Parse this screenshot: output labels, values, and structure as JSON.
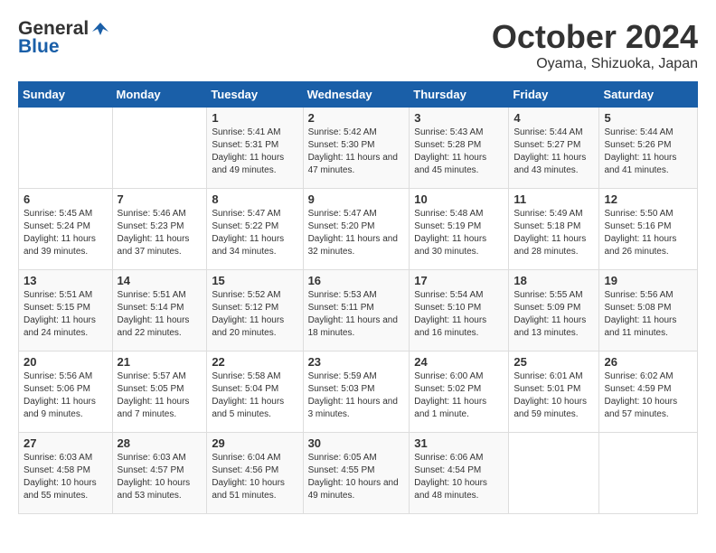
{
  "logo": {
    "general": "General",
    "blue": "Blue"
  },
  "title": "October 2024",
  "location": "Oyama, Shizuoka, Japan",
  "days_of_week": [
    "Sunday",
    "Monday",
    "Tuesday",
    "Wednesday",
    "Thursday",
    "Friday",
    "Saturday"
  ],
  "weeks": [
    [
      {
        "day": "",
        "sunrise": "",
        "sunset": "",
        "daylight": ""
      },
      {
        "day": "",
        "sunrise": "",
        "sunset": "",
        "daylight": ""
      },
      {
        "day": "1",
        "sunrise": "Sunrise: 5:41 AM",
        "sunset": "Sunset: 5:31 PM",
        "daylight": "Daylight: 11 hours and 49 minutes."
      },
      {
        "day": "2",
        "sunrise": "Sunrise: 5:42 AM",
        "sunset": "Sunset: 5:30 PM",
        "daylight": "Daylight: 11 hours and 47 minutes."
      },
      {
        "day": "3",
        "sunrise": "Sunrise: 5:43 AM",
        "sunset": "Sunset: 5:28 PM",
        "daylight": "Daylight: 11 hours and 45 minutes."
      },
      {
        "day": "4",
        "sunrise": "Sunrise: 5:44 AM",
        "sunset": "Sunset: 5:27 PM",
        "daylight": "Daylight: 11 hours and 43 minutes."
      },
      {
        "day": "5",
        "sunrise": "Sunrise: 5:44 AM",
        "sunset": "Sunset: 5:26 PM",
        "daylight": "Daylight: 11 hours and 41 minutes."
      }
    ],
    [
      {
        "day": "6",
        "sunrise": "Sunrise: 5:45 AM",
        "sunset": "Sunset: 5:24 PM",
        "daylight": "Daylight: 11 hours and 39 minutes."
      },
      {
        "day": "7",
        "sunrise": "Sunrise: 5:46 AM",
        "sunset": "Sunset: 5:23 PM",
        "daylight": "Daylight: 11 hours and 37 minutes."
      },
      {
        "day": "8",
        "sunrise": "Sunrise: 5:47 AM",
        "sunset": "Sunset: 5:22 PM",
        "daylight": "Daylight: 11 hours and 34 minutes."
      },
      {
        "day": "9",
        "sunrise": "Sunrise: 5:47 AM",
        "sunset": "Sunset: 5:20 PM",
        "daylight": "Daylight: 11 hours and 32 minutes."
      },
      {
        "day": "10",
        "sunrise": "Sunrise: 5:48 AM",
        "sunset": "Sunset: 5:19 PM",
        "daylight": "Daylight: 11 hours and 30 minutes."
      },
      {
        "day": "11",
        "sunrise": "Sunrise: 5:49 AM",
        "sunset": "Sunset: 5:18 PM",
        "daylight": "Daylight: 11 hours and 28 minutes."
      },
      {
        "day": "12",
        "sunrise": "Sunrise: 5:50 AM",
        "sunset": "Sunset: 5:16 PM",
        "daylight": "Daylight: 11 hours and 26 minutes."
      }
    ],
    [
      {
        "day": "13",
        "sunrise": "Sunrise: 5:51 AM",
        "sunset": "Sunset: 5:15 PM",
        "daylight": "Daylight: 11 hours and 24 minutes."
      },
      {
        "day": "14",
        "sunrise": "Sunrise: 5:51 AM",
        "sunset": "Sunset: 5:14 PM",
        "daylight": "Daylight: 11 hours and 22 minutes."
      },
      {
        "day": "15",
        "sunrise": "Sunrise: 5:52 AM",
        "sunset": "Sunset: 5:12 PM",
        "daylight": "Daylight: 11 hours and 20 minutes."
      },
      {
        "day": "16",
        "sunrise": "Sunrise: 5:53 AM",
        "sunset": "Sunset: 5:11 PM",
        "daylight": "Daylight: 11 hours and 18 minutes."
      },
      {
        "day": "17",
        "sunrise": "Sunrise: 5:54 AM",
        "sunset": "Sunset: 5:10 PM",
        "daylight": "Daylight: 11 hours and 16 minutes."
      },
      {
        "day": "18",
        "sunrise": "Sunrise: 5:55 AM",
        "sunset": "Sunset: 5:09 PM",
        "daylight": "Daylight: 11 hours and 13 minutes."
      },
      {
        "day": "19",
        "sunrise": "Sunrise: 5:56 AM",
        "sunset": "Sunset: 5:08 PM",
        "daylight": "Daylight: 11 hours and 11 minutes."
      }
    ],
    [
      {
        "day": "20",
        "sunrise": "Sunrise: 5:56 AM",
        "sunset": "Sunset: 5:06 PM",
        "daylight": "Daylight: 11 hours and 9 minutes."
      },
      {
        "day": "21",
        "sunrise": "Sunrise: 5:57 AM",
        "sunset": "Sunset: 5:05 PM",
        "daylight": "Daylight: 11 hours and 7 minutes."
      },
      {
        "day": "22",
        "sunrise": "Sunrise: 5:58 AM",
        "sunset": "Sunset: 5:04 PM",
        "daylight": "Daylight: 11 hours and 5 minutes."
      },
      {
        "day": "23",
        "sunrise": "Sunrise: 5:59 AM",
        "sunset": "Sunset: 5:03 PM",
        "daylight": "Daylight: 11 hours and 3 minutes."
      },
      {
        "day": "24",
        "sunrise": "Sunrise: 6:00 AM",
        "sunset": "Sunset: 5:02 PM",
        "daylight": "Daylight: 11 hours and 1 minute."
      },
      {
        "day": "25",
        "sunrise": "Sunrise: 6:01 AM",
        "sunset": "Sunset: 5:01 PM",
        "daylight": "Daylight: 10 hours and 59 minutes."
      },
      {
        "day": "26",
        "sunrise": "Sunrise: 6:02 AM",
        "sunset": "Sunset: 4:59 PM",
        "daylight": "Daylight: 10 hours and 57 minutes."
      }
    ],
    [
      {
        "day": "27",
        "sunrise": "Sunrise: 6:03 AM",
        "sunset": "Sunset: 4:58 PM",
        "daylight": "Daylight: 10 hours and 55 minutes."
      },
      {
        "day": "28",
        "sunrise": "Sunrise: 6:03 AM",
        "sunset": "Sunset: 4:57 PM",
        "daylight": "Daylight: 10 hours and 53 minutes."
      },
      {
        "day": "29",
        "sunrise": "Sunrise: 6:04 AM",
        "sunset": "Sunset: 4:56 PM",
        "daylight": "Daylight: 10 hours and 51 minutes."
      },
      {
        "day": "30",
        "sunrise": "Sunrise: 6:05 AM",
        "sunset": "Sunset: 4:55 PM",
        "daylight": "Daylight: 10 hours and 49 minutes."
      },
      {
        "day": "31",
        "sunrise": "Sunrise: 6:06 AM",
        "sunset": "Sunset: 4:54 PM",
        "daylight": "Daylight: 10 hours and 48 minutes."
      },
      {
        "day": "",
        "sunrise": "",
        "sunset": "",
        "daylight": ""
      },
      {
        "day": "",
        "sunrise": "",
        "sunset": "",
        "daylight": ""
      }
    ]
  ]
}
